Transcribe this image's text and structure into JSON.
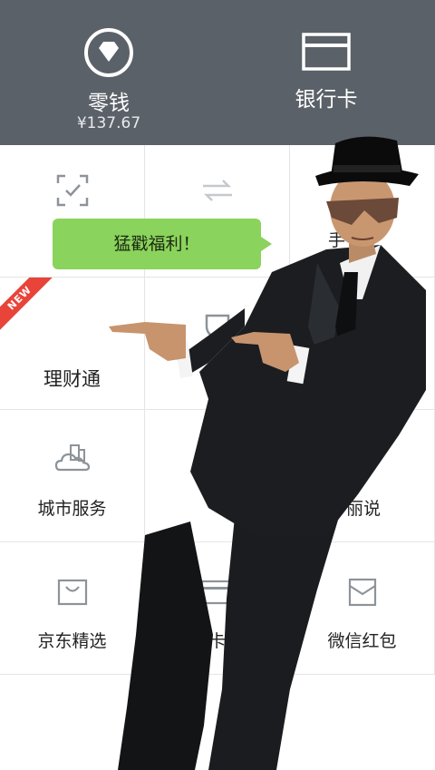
{
  "header": {
    "wallet": {
      "label": "零钱",
      "amount": "¥137.67",
      "icon": "diamond-circle-icon"
    },
    "bank_card": {
      "label": "银行卡",
      "icon": "card-icon"
    }
  },
  "grid": {
    "rows": [
      [
        {
          "label": "",
          "icon": "scan-check-icon"
        },
        {
          "label": "",
          "icon": "transfer-arrows-icon"
        },
        {
          "label": "手",
          "icon": ""
        }
      ],
      [
        {
          "label": "理财通",
          "icon": "",
          "badge": "NEW"
        },
        {
          "label": "",
          "icon": "shield-icon"
        },
        {
          "label": "",
          "icon": ""
        }
      ],
      [
        {
          "label": "城市服务",
          "icon": "city-icon"
        },
        {
          "label": "",
          "icon": ""
        },
        {
          "label": "丽说",
          "icon": ""
        }
      ],
      [
        {
          "label": "京东精选",
          "icon": "shopping-bag-icon"
        },
        {
          "label": "信用卡还款",
          "icon": "credit-card-icon"
        },
        {
          "label": "微信红包",
          "icon": "red-envelope-icon"
        }
      ]
    ]
  },
  "bubble": {
    "text": "猛戳福利！"
  },
  "colors": {
    "header_bg": "#5b6168",
    "bubble_bg": "#8ad35c",
    "ribbon": "#e8443a"
  }
}
